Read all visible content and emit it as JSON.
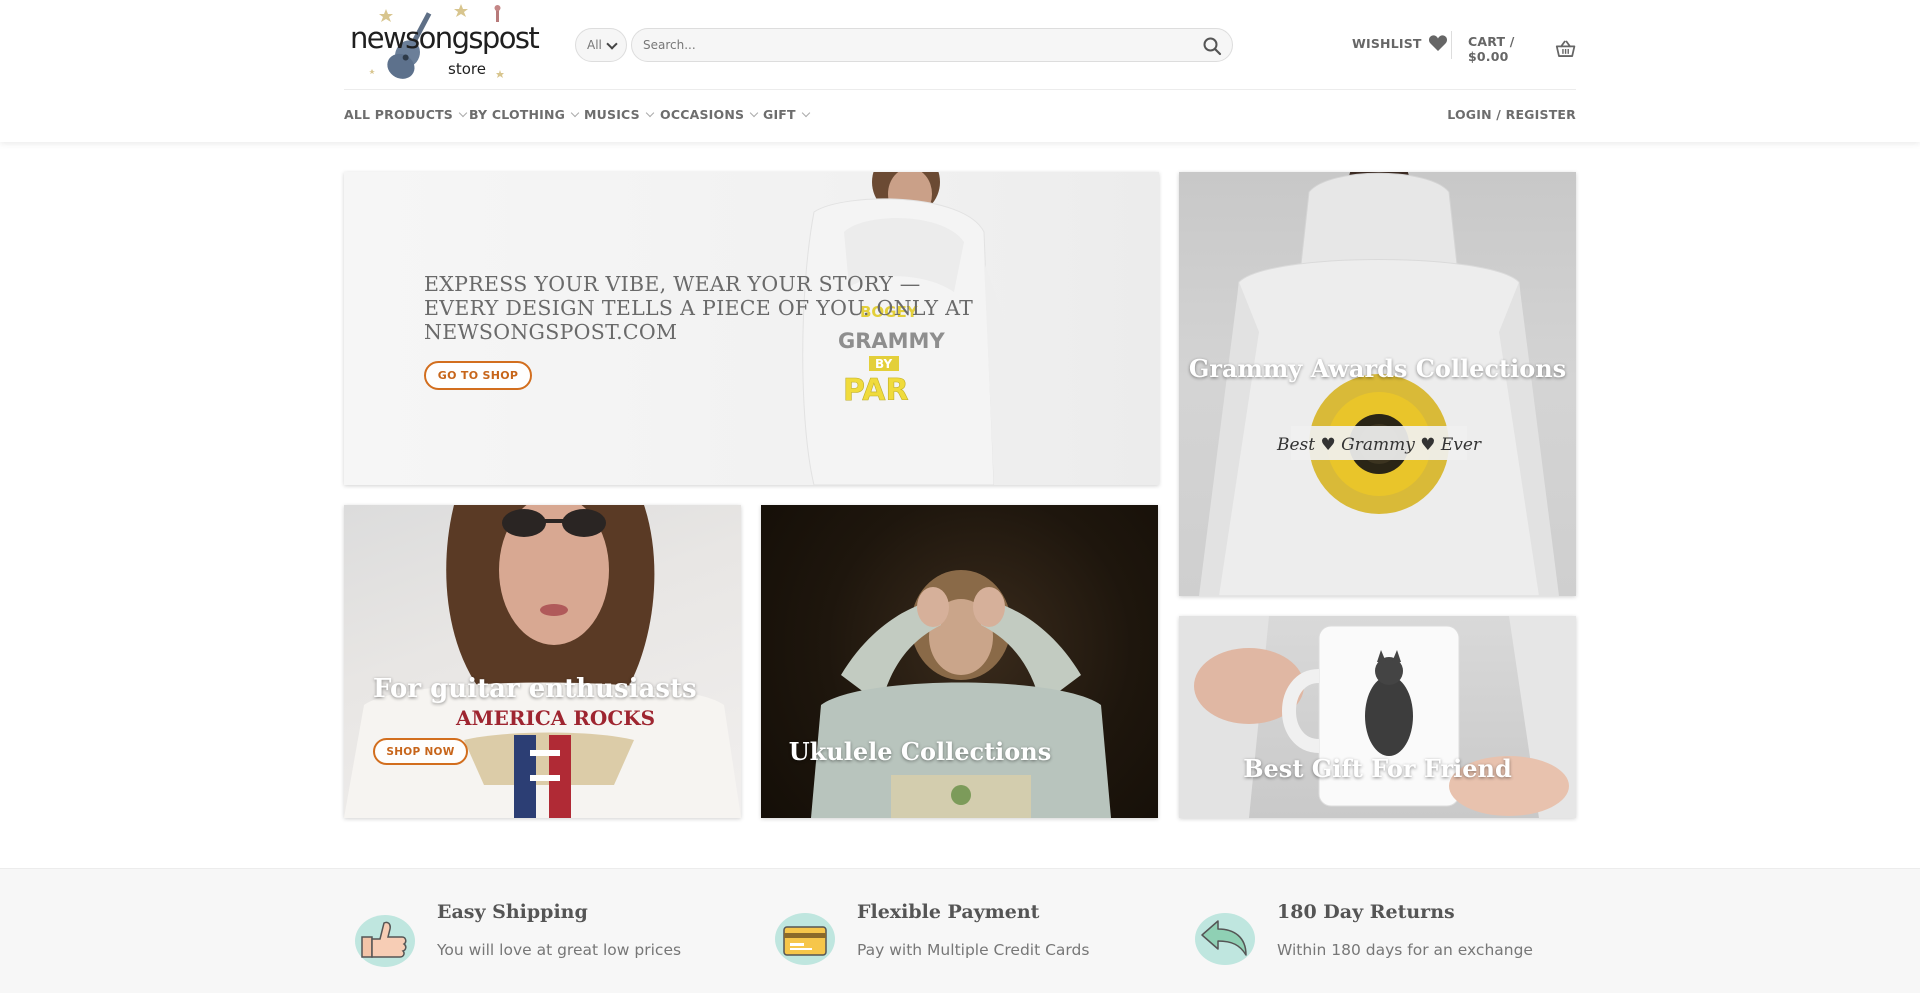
{
  "header": {
    "logo_text": "newsongspost",
    "logo_subtext": "store",
    "category_select": "All",
    "search_placeholder": "Search...",
    "wishlist_label": "WISHLIST",
    "cart_label": "CART / $0.00",
    "login_label": "LOGIN / REGISTER"
  },
  "nav": {
    "items": [
      {
        "label": "ALL PRODUCTS"
      },
      {
        "label": "BY CLOTHING"
      },
      {
        "label": "MUSICS"
      },
      {
        "label": "OCCASIONS"
      },
      {
        "label": "GIFT"
      }
    ]
  },
  "banners": {
    "hero": {
      "title": "EXPRESS YOUR VIBE, WEAR YOUR STORY — EVERY DESIGN TELLS A PIECE OF YOU. ONLY AT NEWSONGSPOST.COM",
      "button": "GO TO SHOP",
      "print_text_1": "BOGEY",
      "print_text_2": "GRAMMY",
      "print_text_3": "BY",
      "print_text_4": "PAR"
    },
    "grammy": {
      "caption": "Grammy Awards Collections",
      "print_text": "Best ♥ Grammy ♥ Ever"
    },
    "guitar": {
      "caption": "For guitar enthusiasts",
      "button": "SHOP NOW",
      "print_text": "AMERICA ROCKS"
    },
    "ukulele": {
      "caption": "Ukulele Collections"
    },
    "gift": {
      "caption": "Best Gift For Friend"
    }
  },
  "features": [
    {
      "title": "Easy Shipping",
      "desc": "You will love at great low prices",
      "icon": "thumbs-up-icon"
    },
    {
      "title": "Flexible Payment",
      "desc": "Pay with Multiple Credit Cards",
      "icon": "credit-card-icon"
    },
    {
      "title": "180 Day Returns",
      "desc": "Within 180 days for an exchange",
      "icon": "return-arrow-icon"
    }
  ],
  "colors": {
    "accent": "#d26e1e",
    "feature_bg": "#f7f7f7",
    "icon_bg": "#bfe6df"
  }
}
